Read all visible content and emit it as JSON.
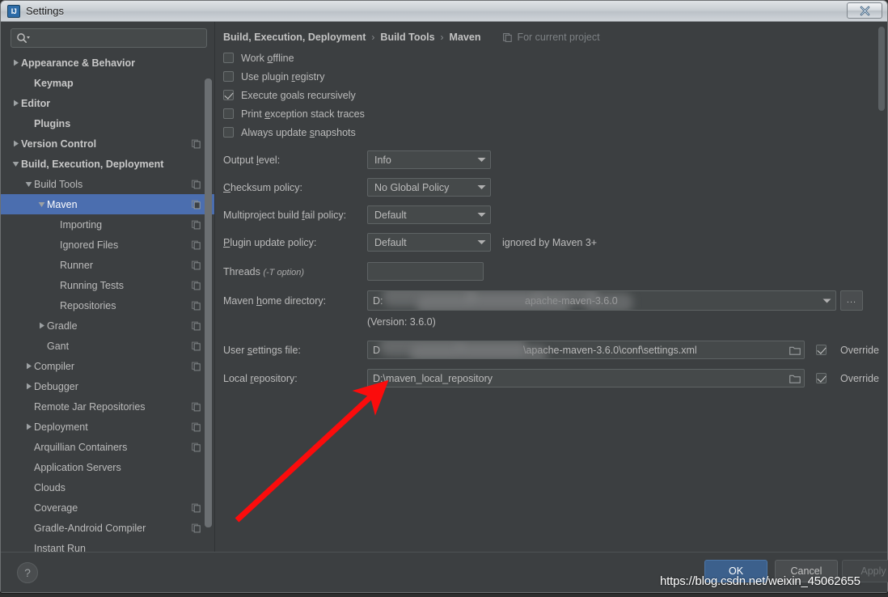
{
  "window": {
    "title": "Settings",
    "app_icon": "intellij-idea-icon",
    "close_label": "close-icon"
  },
  "search": {
    "value": "",
    "placeholder": "",
    "icon": "search-icon"
  },
  "sidebar": {
    "items": [
      {
        "label": "Appearance & Behavior",
        "indent": 0,
        "twisty": "collapsed",
        "bold": true,
        "copy": false,
        "selected": false
      },
      {
        "label": "Keymap",
        "indent": 1,
        "twisty": "none",
        "bold": true,
        "copy": false,
        "selected": false
      },
      {
        "label": "Editor",
        "indent": 0,
        "twisty": "collapsed",
        "bold": true,
        "copy": false,
        "selected": false
      },
      {
        "label": "Plugins",
        "indent": 1,
        "twisty": "none",
        "bold": true,
        "copy": false,
        "selected": false
      },
      {
        "label": "Version Control",
        "indent": 0,
        "twisty": "collapsed",
        "bold": true,
        "copy": true,
        "selected": false
      },
      {
        "label": "Build, Execution, Deployment",
        "indent": 0,
        "twisty": "expanded",
        "bold": true,
        "copy": false,
        "selected": false
      },
      {
        "label": "Build Tools",
        "indent": 1,
        "twisty": "expanded",
        "bold": false,
        "copy": true,
        "selected": false
      },
      {
        "label": "Maven",
        "indent": 2,
        "twisty": "expanded",
        "bold": false,
        "copy": true,
        "selected": true
      },
      {
        "label": "Importing",
        "indent": 3,
        "twisty": "none",
        "bold": false,
        "copy": true,
        "selected": false
      },
      {
        "label": "Ignored Files",
        "indent": 3,
        "twisty": "none",
        "bold": false,
        "copy": true,
        "selected": false
      },
      {
        "label": "Runner",
        "indent": 3,
        "twisty": "none",
        "bold": false,
        "copy": true,
        "selected": false
      },
      {
        "label": "Running Tests",
        "indent": 3,
        "twisty": "none",
        "bold": false,
        "copy": true,
        "selected": false
      },
      {
        "label": "Repositories",
        "indent": 3,
        "twisty": "none",
        "bold": false,
        "copy": true,
        "selected": false
      },
      {
        "label": "Gradle",
        "indent": 2,
        "twisty": "collapsed",
        "bold": false,
        "copy": true,
        "selected": false
      },
      {
        "label": "Gant",
        "indent": 2,
        "twisty": "none",
        "bold": false,
        "copy": true,
        "selected": false
      },
      {
        "label": "Compiler",
        "indent": 1,
        "twisty": "collapsed",
        "bold": false,
        "copy": true,
        "selected": false
      },
      {
        "label": "Debugger",
        "indent": 1,
        "twisty": "collapsed",
        "bold": false,
        "copy": false,
        "selected": false
      },
      {
        "label": "Remote Jar Repositories",
        "indent": 1,
        "twisty": "none",
        "bold": false,
        "copy": true,
        "selected": false
      },
      {
        "label": "Deployment",
        "indent": 1,
        "twisty": "collapsed",
        "bold": false,
        "copy": true,
        "selected": false
      },
      {
        "label": "Arquillian Containers",
        "indent": 1,
        "twisty": "none",
        "bold": false,
        "copy": true,
        "selected": false
      },
      {
        "label": "Application Servers",
        "indent": 1,
        "twisty": "none",
        "bold": false,
        "copy": false,
        "selected": false
      },
      {
        "label": "Clouds",
        "indent": 1,
        "twisty": "none",
        "bold": false,
        "copy": false,
        "selected": false
      },
      {
        "label": "Coverage",
        "indent": 1,
        "twisty": "none",
        "bold": false,
        "copy": true,
        "selected": false
      },
      {
        "label": "Gradle-Android Compiler",
        "indent": 1,
        "twisty": "none",
        "bold": false,
        "copy": true,
        "selected": false
      },
      {
        "label": "Instant Run",
        "indent": 1,
        "twisty": "none",
        "bold": false,
        "copy": false,
        "selected": false
      }
    ]
  },
  "main": {
    "breadcrumb": [
      "Build, Execution, Deployment",
      "Build Tools",
      "Maven"
    ],
    "breadcrumb_separator": "›",
    "scope_label": "For current project",
    "scope_icon": "copy-scope-icon",
    "checkboxes": [
      {
        "label_pre": "Work ",
        "accel": "o",
        "label_post": "ffline",
        "checked": false
      },
      {
        "label_pre": "Use plugin ",
        "accel": "r",
        "label_post": "egistry",
        "checked": false
      },
      {
        "label_pre": "Execute ",
        "accel": "g",
        "label_post": "oals recursively",
        "checked": true
      },
      {
        "label_pre": "Print ",
        "accel": "e",
        "label_post": "xception stack traces",
        "checked": false
      },
      {
        "label_pre": "Always update ",
        "accel": "s",
        "label_post": "napshots",
        "checked": false
      }
    ],
    "fields": {
      "output_level": {
        "label_pre": "Output ",
        "accel": "l",
        "label_post": "evel:",
        "value": "Info"
      },
      "checksum_policy": {
        "label_pre": "",
        "accel": "C",
        "label_post": "hecksum policy:",
        "value": "No Global Policy"
      },
      "multiproject": {
        "label_pre": "Multiproject build ",
        "accel": "f",
        "label_post": "ail policy:",
        "value": "Default"
      },
      "plugin_update": {
        "label_pre": "",
        "accel": "P",
        "label_post": "lugin update policy:",
        "value": "Default",
        "hint": "ignored by Maven 3+"
      },
      "threads": {
        "label": "Threads",
        "note": "(-T option)",
        "value": ""
      },
      "maven_home": {
        "label_pre": "Maven ",
        "accel": "h",
        "label_post": "ome directory:",
        "value_prefix": "D:",
        "value_suffix": "apache-maven-3.6.0",
        "version_note": "(Version: 3.6.0)"
      },
      "user_settings": {
        "label_pre": "User ",
        "accel": "s",
        "label_post": "ettings file:",
        "value_prefix": "D",
        "value_suffix": "\\apache-maven-3.6.0\\conf\\settings.xml",
        "override_label": "Override",
        "override_checked": true
      },
      "local_repo": {
        "label_pre": "Local ",
        "accel": "r",
        "label_post": "epository:",
        "value": "D:\\maven_local_repository",
        "override_label": "Override",
        "override_checked": true
      }
    },
    "browse_button_label": "..."
  },
  "footer": {
    "help_label": "?",
    "ok_label": "OK",
    "cancel_label": "Cancel",
    "apply_label": "Apply"
  },
  "annotations": {
    "watermark": "https://blog.csdn.net/weixin_45062655",
    "arrow_color": "#fb0c0c"
  }
}
